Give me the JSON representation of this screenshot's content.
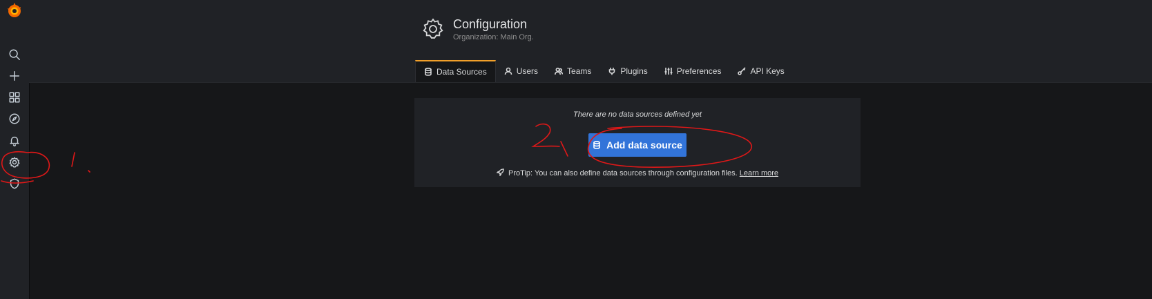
{
  "sidebar": {
    "logo": "grafana-logo",
    "items": [
      {
        "icon": "search-icon"
      },
      {
        "icon": "plus-icon"
      },
      {
        "icon": "dashboards-grid-icon"
      },
      {
        "icon": "compass-icon"
      },
      {
        "icon": "bell-icon"
      },
      {
        "icon": "gear-icon"
      },
      {
        "icon": "shield-icon"
      }
    ]
  },
  "header": {
    "title": "Configuration",
    "subtitle": "Organization: Main Org.",
    "icon": "gear-icon"
  },
  "tabs": [
    {
      "label": "Data Sources",
      "icon": "database-icon",
      "active": true
    },
    {
      "label": "Users",
      "icon": "user-icon",
      "active": false
    },
    {
      "label": "Teams",
      "icon": "users-icon",
      "active": false
    },
    {
      "label": "Plugins",
      "icon": "plug-icon",
      "active": false
    },
    {
      "label": "Preferences",
      "icon": "sliders-icon",
      "active": false
    },
    {
      "label": "API Keys",
      "icon": "key-icon",
      "active": false
    }
  ],
  "empty_state": {
    "message": "There are no data sources defined yet",
    "button_label": "Add data source",
    "protip": "ProTip: You can also define data sources through configuration files.",
    "learn_more": "Learn more"
  },
  "colors": {
    "accent": "#3274d9",
    "active_tab_border": "#f2a02a",
    "annotation": "#e01818"
  },
  "annotations": {
    "step1": "1.",
    "step2": "2."
  }
}
